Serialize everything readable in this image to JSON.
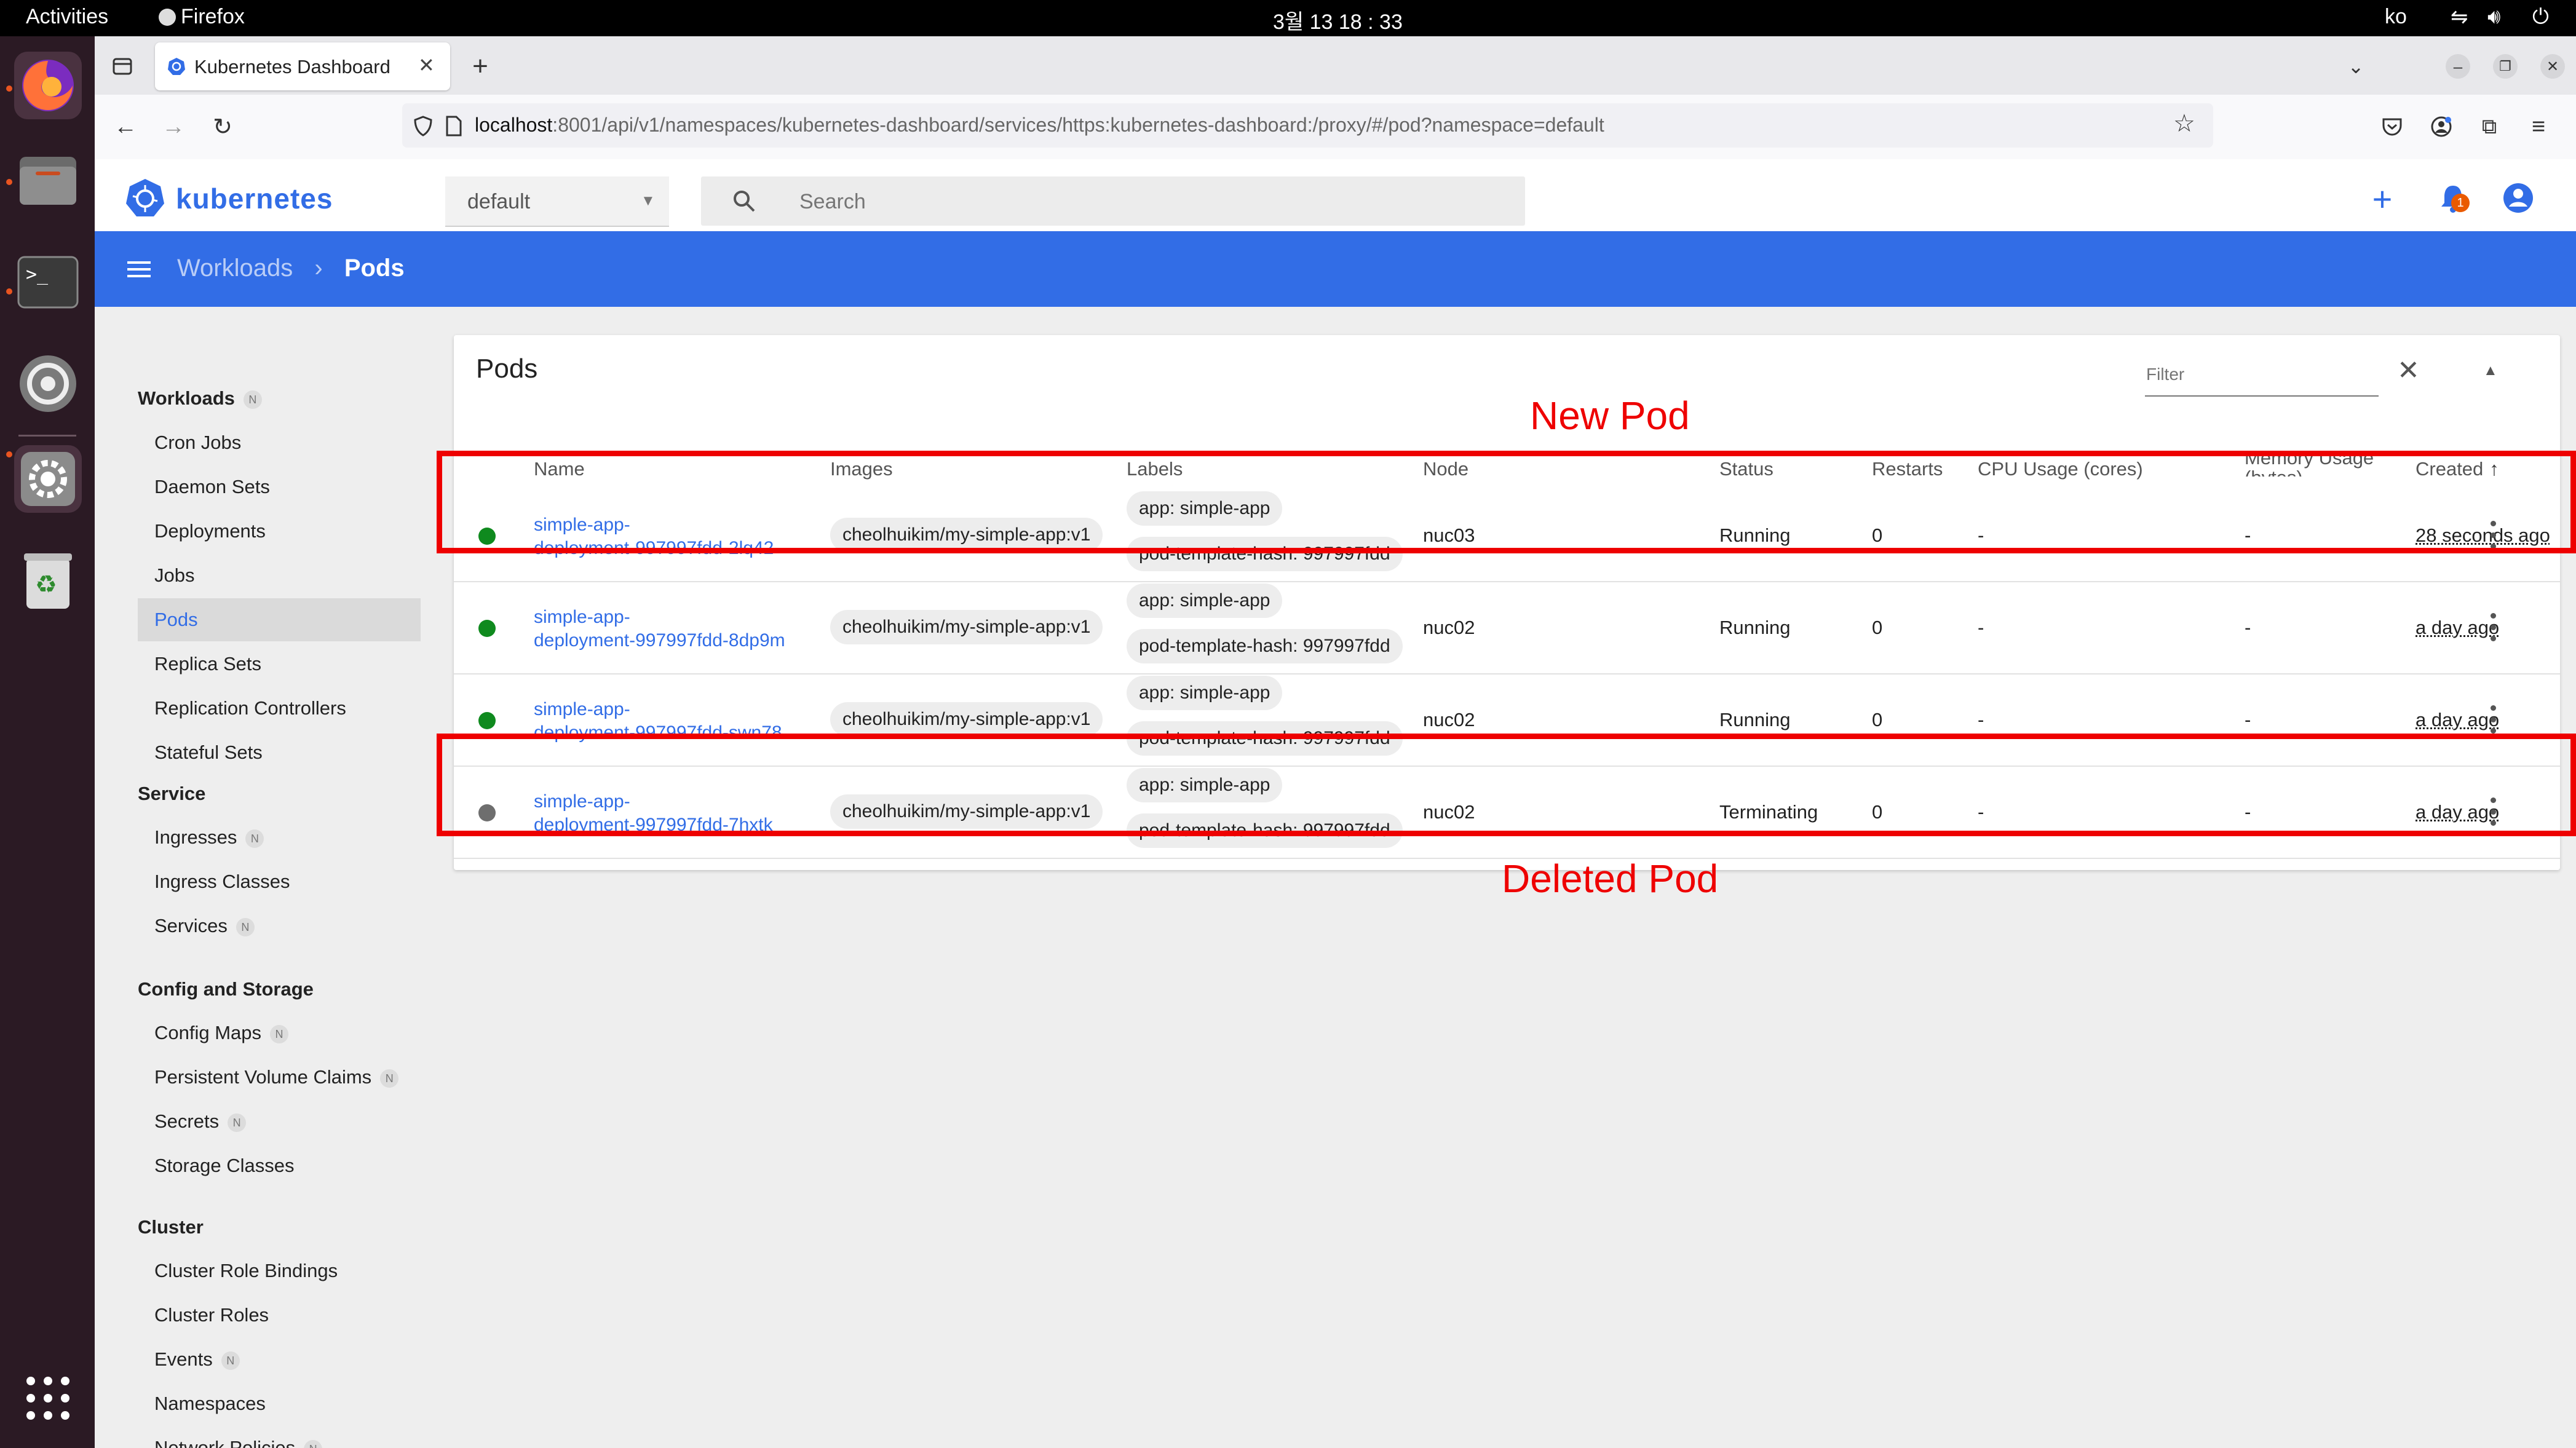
{
  "topbar": {
    "activities": "Activities",
    "app": "Firefox",
    "clock": "3월 13  18 : 33",
    "lang": "ko"
  },
  "browser": {
    "tab_title": "Kubernetes Dashboard",
    "url_host": "localhost",
    "url_rest": ":8001/api/v1/namespaces/kubernetes-dashboard/services/https:kubernetes-dashboard:/proxy/#/pod?namespace=default"
  },
  "k8s": {
    "brand": "kubernetes",
    "namespace": "default",
    "search_placeholder": "Search",
    "notification_count": "1",
    "breadcrumb": {
      "parent": "Workloads",
      "sep": "›",
      "current": "Pods"
    }
  },
  "sidebar": {
    "sections": [
      {
        "title": "Workloads",
        "badge": "N",
        "items": [
          {
            "label": "Cron Jobs"
          },
          {
            "label": "Daemon Sets"
          },
          {
            "label": "Deployments"
          },
          {
            "label": "Jobs"
          },
          {
            "label": "Pods",
            "active": true
          },
          {
            "label": "Replica Sets"
          },
          {
            "label": "Replication Controllers"
          },
          {
            "label": "Stateful Sets"
          }
        ]
      },
      {
        "title": "Service",
        "items": [
          {
            "label": "Ingresses",
            "badge": "N"
          },
          {
            "label": "Ingress Classes"
          },
          {
            "label": "Services",
            "badge": "N"
          }
        ]
      },
      {
        "title": "Config and Storage",
        "items": [
          {
            "label": "Config Maps",
            "badge": "N"
          },
          {
            "label": "Persistent Volume Claims",
            "badge": "N"
          },
          {
            "label": "Secrets",
            "badge": "N"
          },
          {
            "label": "Storage Classes"
          }
        ]
      },
      {
        "title": "Cluster",
        "items": [
          {
            "label": "Cluster Role Bindings"
          },
          {
            "label": "Cluster Roles"
          },
          {
            "label": "Events",
            "badge": "N"
          },
          {
            "label": "Namespaces"
          },
          {
            "label": "Network Policies",
            "badge": "N"
          }
        ]
      }
    ]
  },
  "pods": {
    "title": "Pods",
    "filter_placeholder": "Filter",
    "columns": {
      "name": "Name",
      "images": "Images",
      "labels": "Labels",
      "node": "Node",
      "status": "Status",
      "restarts": "Restarts",
      "cpu": "CPU Usage (cores)",
      "memory": "Memory Usage (bytes)",
      "created": "Created"
    },
    "rows": [
      {
        "name1": "simple-app-",
        "name2": "deployment-997997fdd-2lq42",
        "image": "cheolhuikim/my-simple-app:v1",
        "label1": "app: simple-app",
        "label2": "pod-template-hash: 997997fdd",
        "node": "nuc03",
        "status": "Running",
        "restarts": "0",
        "cpu": "-",
        "memory": "-",
        "created": "28 seconds ago",
        "state_color": "#0f8a1e"
      },
      {
        "name1": "simple-app-",
        "name2": "deployment-997997fdd-8dp9m",
        "image": "cheolhuikim/my-simple-app:v1",
        "label1": "app: simple-app",
        "label2": "pod-template-hash: 997997fdd",
        "node": "nuc02",
        "status": "Running",
        "restarts": "0",
        "cpu": "-",
        "memory": "-",
        "created": "a day ago",
        "state_color": "#0f8a1e"
      },
      {
        "name1": "simple-app-",
        "name2": "deployment-997997fdd-swn78",
        "image": "cheolhuikim/my-simple-app:v1",
        "label1": "app: simple-app",
        "label2": "pod-template-hash: 997997fdd",
        "node": "nuc02",
        "status": "Running",
        "restarts": "0",
        "cpu": "-",
        "memory": "-",
        "created": "a day ago",
        "state_color": "#0f8a1e"
      },
      {
        "name1": "simple-app-",
        "name2": "deployment-997997fdd-7hxtk",
        "image": "cheolhuikim/my-simple-app:v1",
        "label1": "app: simple-app",
        "label2": "pod-template-hash: 997997fdd",
        "node": "nuc02",
        "status": "Terminating",
        "restarts": "0",
        "cpu": "-",
        "memory": "-",
        "created": "a day ago",
        "state_color": "#6e6e6e"
      }
    ]
  },
  "annotations": {
    "new": "New Pod",
    "deleted": "Deleted Pod"
  },
  "colors": {
    "accent": "#326de6",
    "annotation": "#ee0000",
    "running": "#0f8a1e",
    "terminating": "#6e6e6e"
  }
}
